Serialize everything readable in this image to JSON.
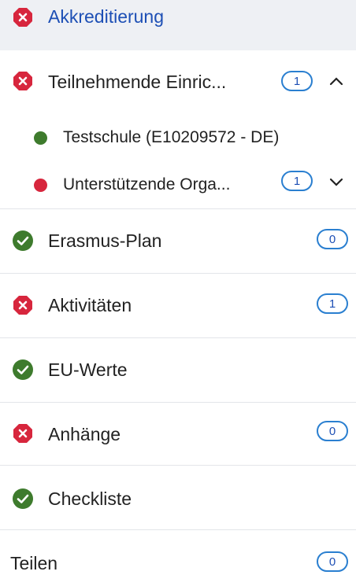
{
  "sidebar": {
    "items": [
      {
        "label": "Akkreditierung",
        "status": "error"
      },
      {
        "label": "Teilnehmende Einric...",
        "status": "error",
        "badge": "1",
        "expanded": true
      },
      {
        "label": "Testschule (E10209572 - DE)",
        "status": "ok"
      },
      {
        "label": "Unterstützende Orga...",
        "status": "error",
        "badge": "1"
      },
      {
        "label": "Erasmus-Plan",
        "status": "ok",
        "badge": "0"
      },
      {
        "label": "Aktivitäten",
        "status": "error",
        "badge": "1"
      },
      {
        "label": "EU-Werte",
        "status": "ok"
      },
      {
        "label": "Anhänge",
        "status": "error",
        "badge": "0"
      },
      {
        "label": "Checkliste",
        "status": "ok"
      },
      {
        "label": "Teilen",
        "badge": "0"
      }
    ]
  },
  "colors": {
    "error": "#d7263d",
    "ok": "#3e7b2d",
    "accent": "#2a7fd0",
    "link": "#1d4fb5"
  },
  "icons": {
    "error": "error-x-octagon-icon",
    "ok": "check-circle-icon",
    "expanded": "chevron-up-icon",
    "collapsed": "chevron-down-icon"
  }
}
